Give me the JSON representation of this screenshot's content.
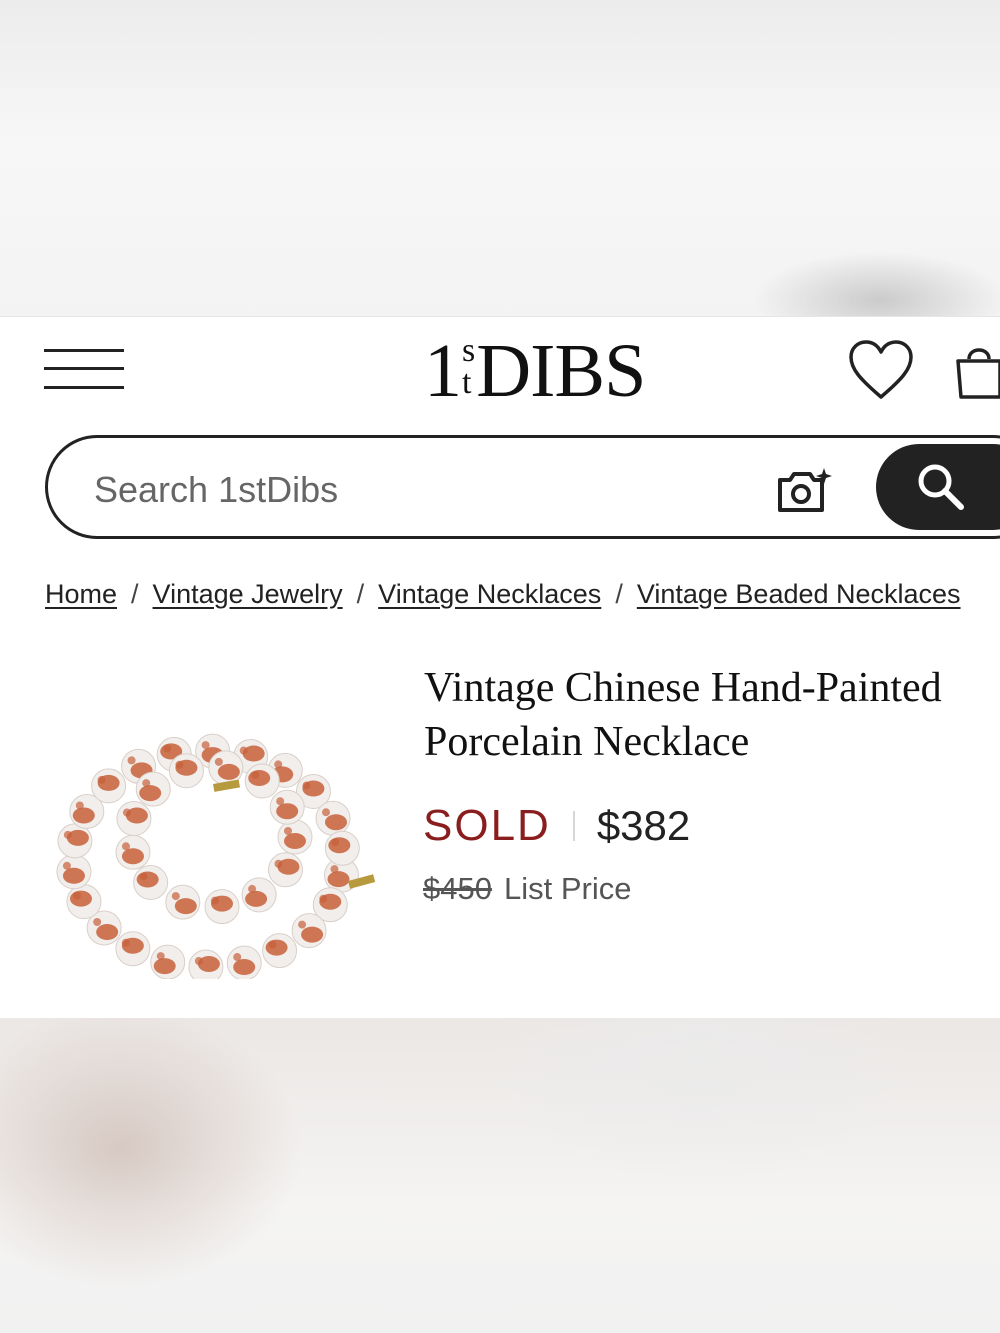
{
  "header": {
    "logo": {
      "one": "1",
      "s": "s",
      "t": "t",
      "dibs": "DIBS"
    }
  },
  "search": {
    "placeholder": "Search 1stDibs"
  },
  "breadcrumb": [
    {
      "label": "Home"
    },
    {
      "label": "Vintage Jewelry"
    },
    {
      "label": "Vintage Necklaces"
    },
    {
      "label": "Vintage Beaded Necklaces"
    }
  ],
  "breadcrumb_separator": "/",
  "product": {
    "title_line1": "Vintage Chinese Hand-Painted",
    "title_line2": "Porcelain Necklace",
    "status": "SOLD",
    "price": "$382",
    "list_price": "$450",
    "list_price_label": "List Price"
  },
  "colors": {
    "sold": "#8a1e1e",
    "bead_paint": "#c8603a",
    "bead_base": "#f1eeec",
    "dark": "#222222"
  },
  "icons": [
    "menu-icon",
    "heart-icon",
    "shopping-bag-icon",
    "camera-sparkle-icon",
    "search-icon"
  ]
}
